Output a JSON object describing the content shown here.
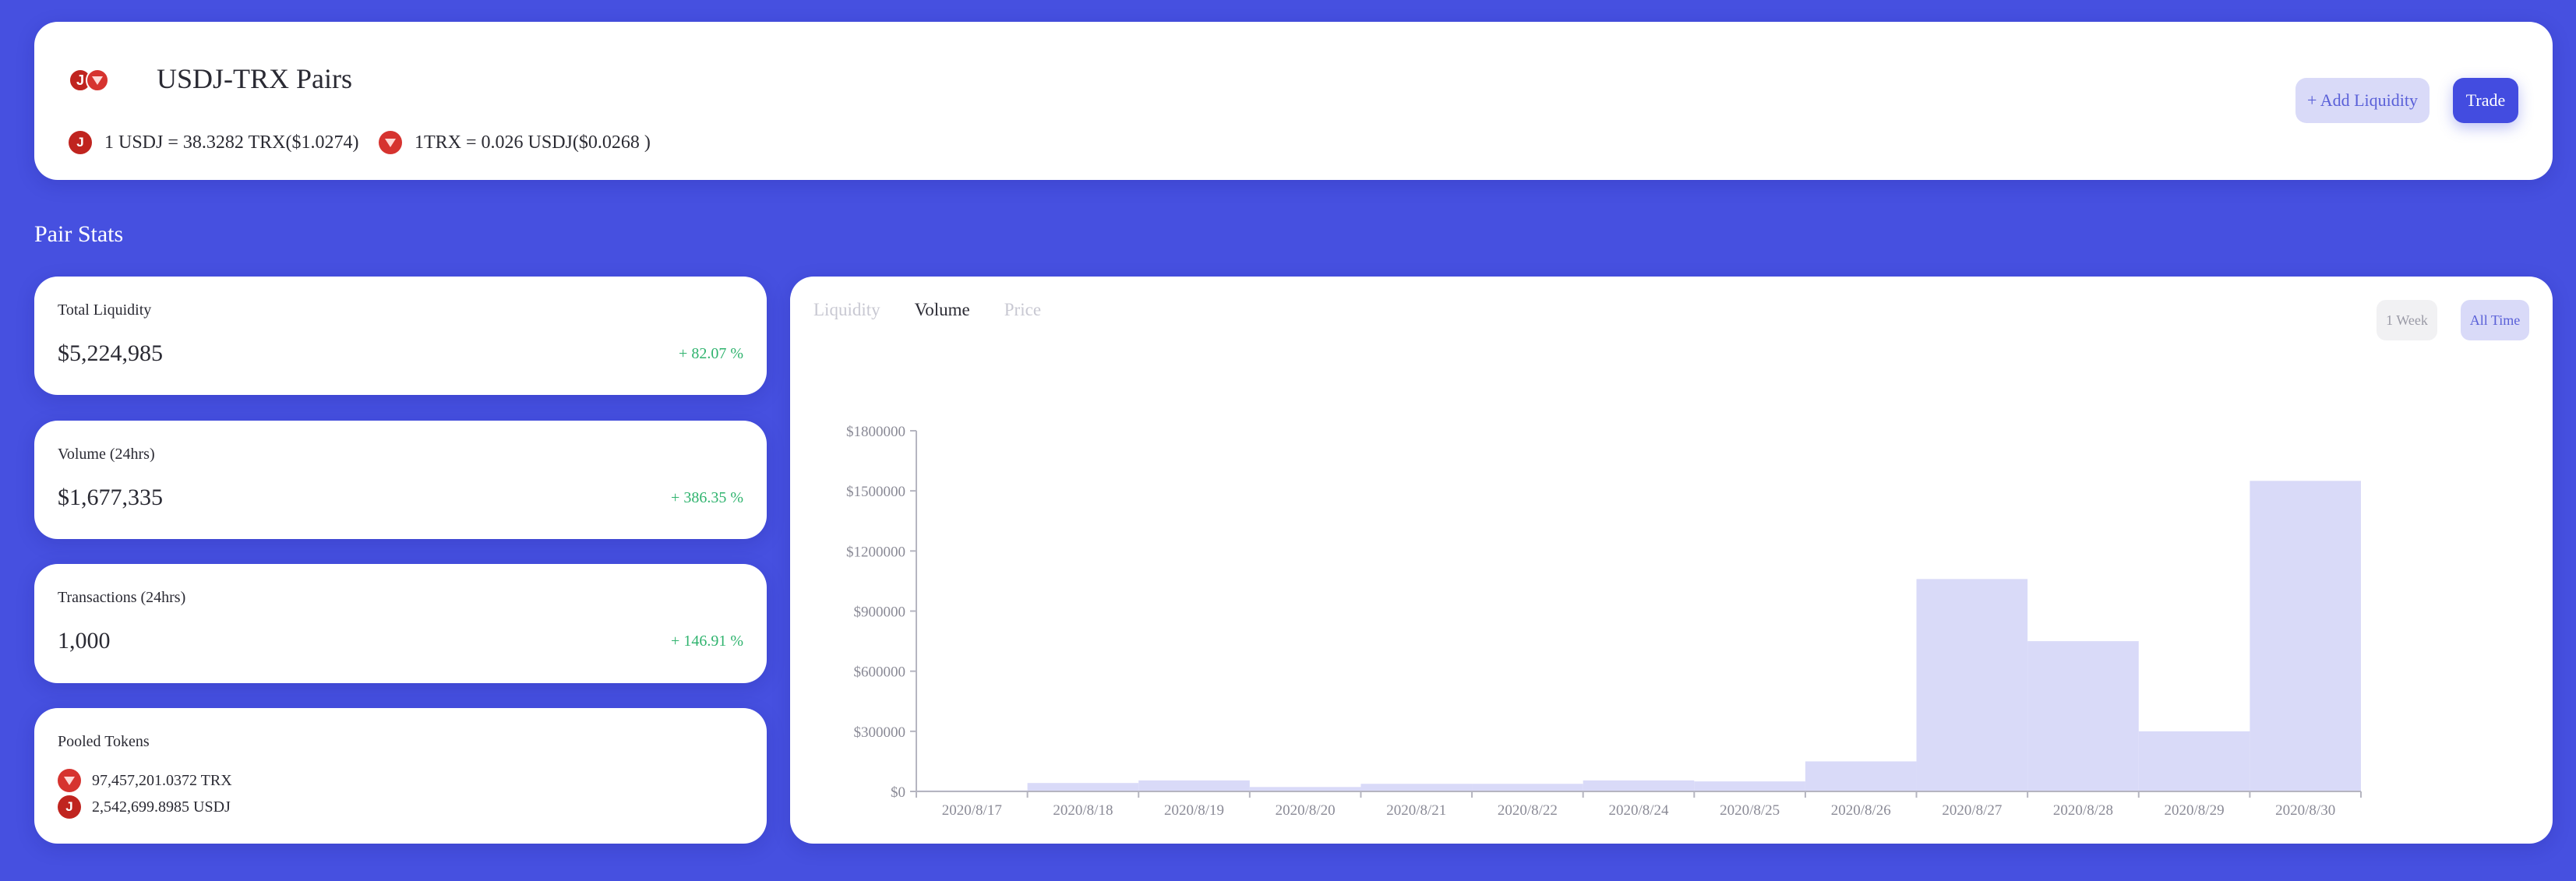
{
  "header": {
    "pair_title": "USDJ-TRX Pairs",
    "rate1": "1 USDJ = 38.3282 TRX($1.0274)",
    "rate2": "1TRX = 0.026 USDJ($0.0268 )",
    "usdj_icon_glyph": "J",
    "add_liquidity_label": "+ Add Liquidity",
    "trade_label": "Trade",
    "icons": [
      "usdj-token-icon",
      "trx-token-icon"
    ]
  },
  "section_title": "Pair Stats",
  "stats": {
    "total_liquidity": {
      "label": "Total Liquidity",
      "value": "$5,224,985",
      "change": "+ 82.07 %"
    },
    "volume": {
      "label": "Volume (24hrs)",
      "value": "$1,677,335",
      "change": "+ 386.35 %"
    },
    "transactions": {
      "label": "Transactions (24hrs)",
      "value": "1,000",
      "change": "+ 146.91 %"
    },
    "pooled": {
      "label": "Pooled Tokens",
      "trx": "97,457,201.0372 TRX",
      "usdj": "2,542,699.8985 USDJ"
    }
  },
  "chart_panel": {
    "tabs": [
      "Liquidity",
      "Volume",
      "Price"
    ],
    "active_tab": "Volume",
    "range_week": "1 Week",
    "range_all": "All Time",
    "active_range": "All Time"
  },
  "colors": {
    "background": "#4650e0",
    "accent": "#434ce0",
    "positive": "#2fb36e",
    "bar": "#d9daf8",
    "token_red": "#c0241f"
  },
  "chart_data": {
    "type": "bar",
    "title": "",
    "xlabel": "",
    "ylabel": "",
    "categories": [
      "2020/8/17",
      "2020/8/18",
      "2020/8/19",
      "2020/8/20",
      "2020/8/21",
      "2020/8/22",
      "2020/8/24",
      "2020/8/25",
      "2020/8/26",
      "2020/8/27",
      "2020/8/28",
      "2020/8/29",
      "2020/8/30"
    ],
    "values": [
      5000,
      42000,
      55000,
      22000,
      38000,
      38000,
      55000,
      50000,
      150000,
      1060000,
      750000,
      300000,
      1550000
    ],
    "ylim": [
      0,
      1800000
    ],
    "yticks": [
      0,
      300000,
      600000,
      900000,
      1200000,
      1500000,
      1800000
    ],
    "ytick_labels": [
      "$0",
      "$300000",
      "$600000",
      "$900000",
      "$1200000",
      "$1500000",
      "$1800000"
    ],
    "grid": false
  }
}
